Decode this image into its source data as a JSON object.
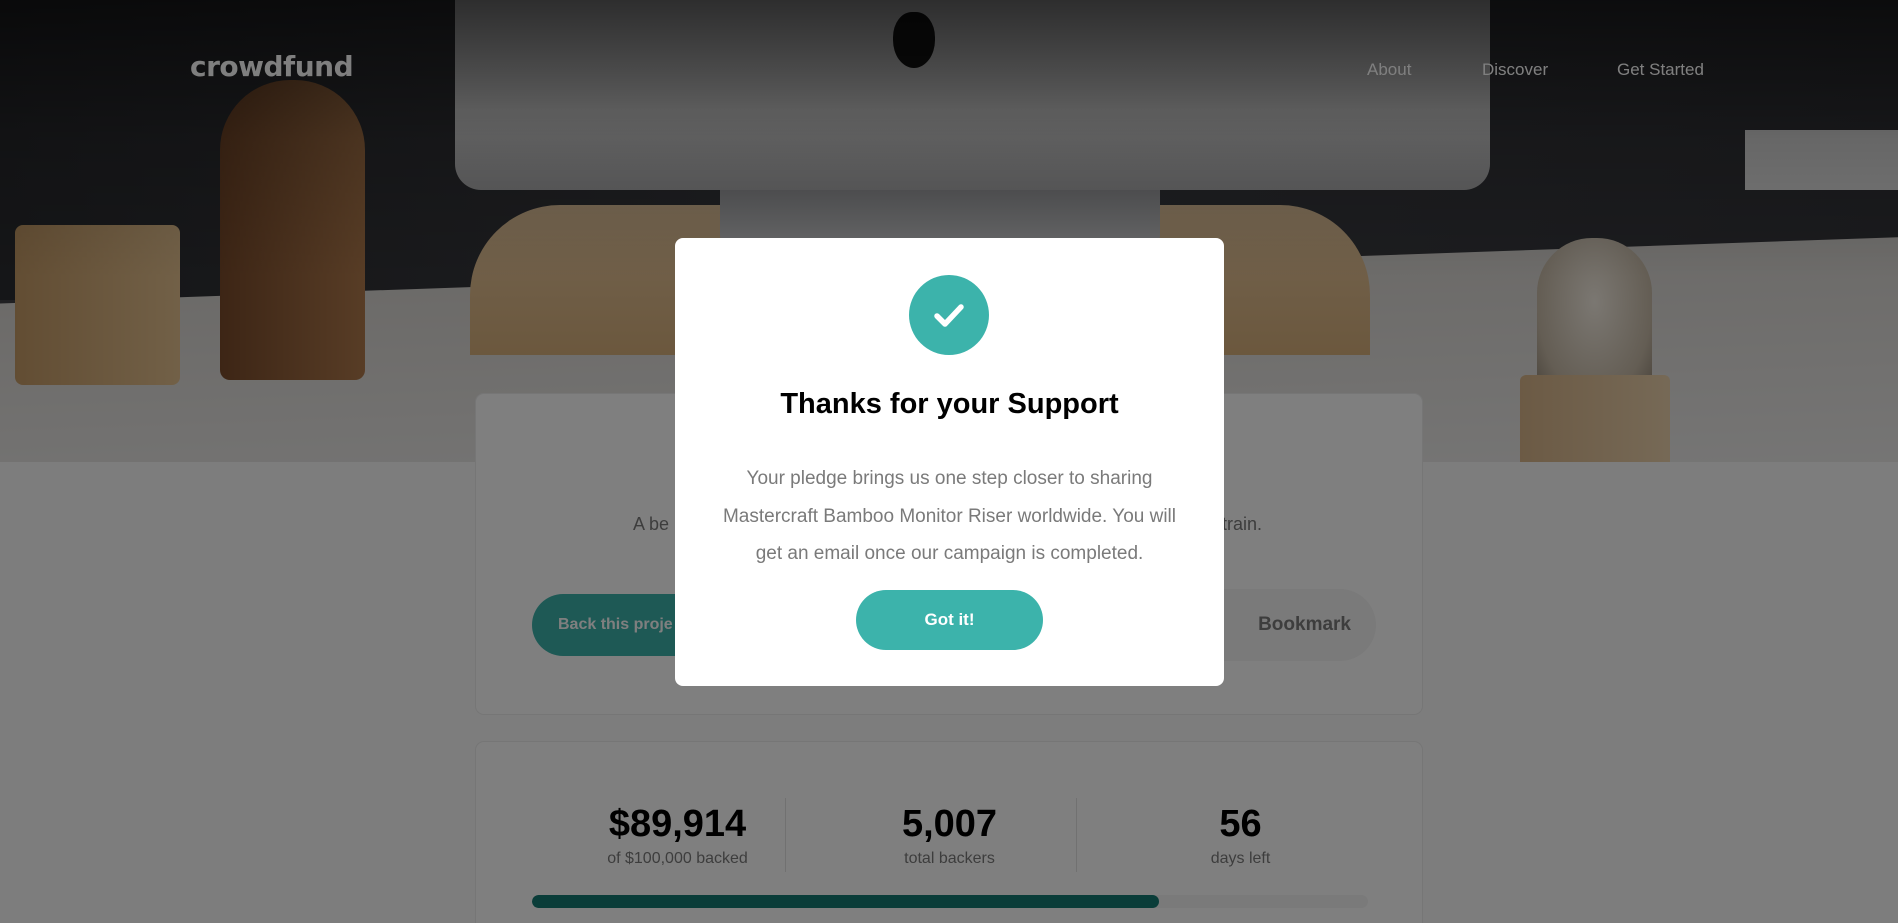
{
  "header": {
    "logo": "crowdfund",
    "nav": [
      {
        "label": "About"
      },
      {
        "label": "Discover"
      },
      {
        "label": "Get Started"
      }
    ]
  },
  "project": {
    "description_visible": "A be",
    "description_visible_end": "train.",
    "back_button_label": "Back this proje",
    "bookmark_label": "Bookmark"
  },
  "stats": {
    "backed_amount": "$89,914",
    "backed_caption": "of $100,000 backed",
    "total_backers": "5,007",
    "backers_caption": "total backers",
    "days_left": "56",
    "days_caption": "days left",
    "progress_fraction": 0.75
  },
  "modal": {
    "icon": "check-icon",
    "title": "Thanks for your Support",
    "body": "Your pledge brings us one step closer to sharing Mastercraft Bamboo Monitor Riser worldwide. You will get an email once our campaign is completed.",
    "button_label": "Got it!"
  },
  "colors": {
    "accent": "#3cb3ab",
    "accent_dark": "#147a73",
    "text_gray": "#7a7a7a"
  }
}
